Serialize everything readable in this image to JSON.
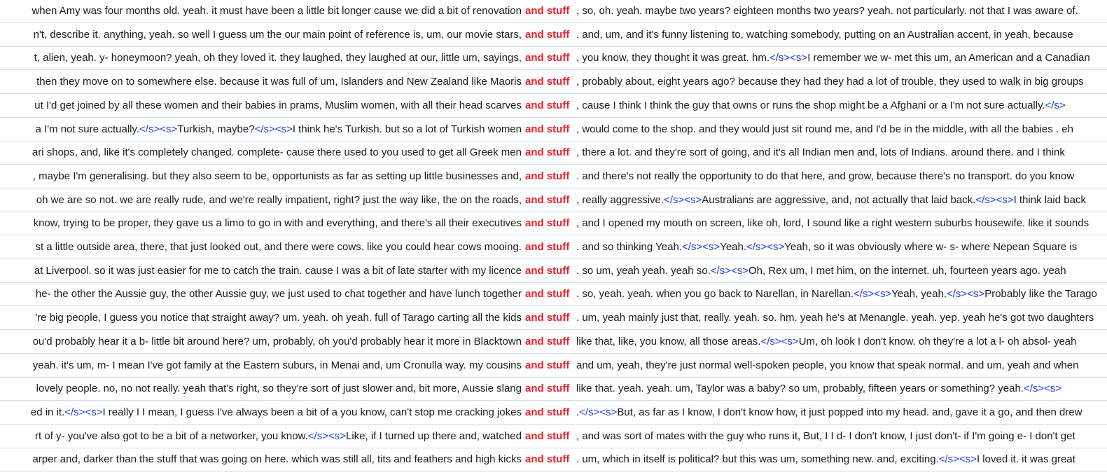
{
  "keyword": "and stuff",
  "colors": {
    "keyword": "#e8202a",
    "tag": "#1f3fe0",
    "row_border": "#c9dff0"
  },
  "rows": [
    {
      "left": "when Amy was four months old. yeah. it must have been a little bit longer cause we did a bit of renovation",
      "right": [
        " , so, oh. yeah. maybe two years? eighteen months two years? yeah. not particularly. not that I was aware of."
      ]
    },
    {
      "left": "n't, describe it. anything, yeah. so well I guess um the our main point of reference is, um, our movie stars,",
      "right": [
        " . and, um, and it's funny listening to, watching somebody, putting on an Australian accent, in yeah, because"
      ]
    },
    {
      "left": "t, alien, yeah. y- honeymoon? yeah, oh they loved it. they laughed, they laughed at our, little um, sayings,",
      "right": [
        " , you know, they thought it was great. hm.",
        "</s><s>",
        "I remember we w- met this um, an American and a Canadian"
      ]
    },
    {
      "left": "then they move on to somewhere else. because it was full of um, Islanders and New Zealand like Maoris",
      "right": [
        " , probably about, eight years ago? because they had they had a lot of trouble, they used to walk in big groups"
      ]
    },
    {
      "left": "ut I'd get joined by all these women and their babies in prams, Muslim women, with all their head scarves",
      "right": [
        " , cause I think I think the guy that owns or runs the shop might be a Afghani or a I'm not sure actually.",
        "</s>"
      ]
    },
    {
      "left": "a I'm not sure actually.</s><s>Turkish, maybe?</s><s>I think he's Turkish. but so a lot of Turkish women",
      "right": [
        " , would come to the shop. and they would just sit round me, and I'd be in the middle, with all the babies . eh"
      ]
    },
    {
      "left": "ari shops, and, like it's completely changed. complete- cause there used to you used to get all Greek men",
      "right": [
        " , there a lot. and they're sort of going, and it's all Indian men and, lots of Indians. around there. and I think"
      ]
    },
    {
      "left": ", maybe I'm generalising. but they also seem to be, opportunists as far as setting up little businesses and,",
      "right": [
        " . and there's not really the opportunity to do that here, and grow, because there's no transport. do you know"
      ]
    },
    {
      "left": "oh we are so not. we are really rude, and we're really impatient, right? just the way like, the on the roads,",
      "right": [
        " , really aggressive.",
        "</s><s>",
        "Australians are aggressive, and, not actually that laid back.",
        "</s><s>",
        "I think laid back"
      ]
    },
    {
      "left": "know, trying to be proper, they gave us a limo to go in with and everything, and there's all their executives",
      "right": [
        " , and I opened my mouth on screen, like oh, lord, I sound like a right western suburbs housewife. like it sounds"
      ]
    },
    {
      "left": "st a little outside area, there, that just looked out, and there were cows. like you could hear cows mooing.",
      "right": [
        " . and so thinking Yeah.",
        "</s><s>",
        "Yeah.",
        "</s><s>",
        "Yeah, so it was obviously where w- s- where Nepean Square is"
      ]
    },
    {
      "left": "at Liverpool. so it was just easier for me to catch the train. cause I was a bit of late starter with my licence",
      "right": [
        " . so um, yeah yeah. yeah so.",
        "</s><s>",
        "Oh, Rex um, I met him, on the internet. uh, fourteen years ago. yeah"
      ]
    },
    {
      "left": "he- the other the Aussie guy, the other Aussie guy, we just used to chat together and have lunch together",
      "right": [
        " . so, yeah. yeah. when you go back to Narellan, in Narellan.",
        "</s><s>",
        "Yeah, yeah.",
        "</s><s>",
        "Probably like the Tarago"
      ]
    },
    {
      "left": "'re big people, I guess you notice that straight away? um. yeah. oh yeah. full of Tarago carting all the kids",
      "right": [
        " . um, yeah mainly just that, really. yeah. so. hm. yeah he's at Menangle. yeah. yep. yeah he's got two daughters"
      ]
    },
    {
      "left": "ou'd probably hear it a b- little bit around here? um, probably, oh you'd probably hear it more in Blacktown",
      "right": [
        " like that, like, you know, all those areas.",
        "</s><s>",
        "Um, oh look I don't know. oh they're a lot a l- oh absol- yeah"
      ]
    },
    {
      "left": "yeah. it's um, m- I mean I've got family at the Eastern suburs, in Menai and, um Cronulla way. my cousins",
      "right": [
        " and um, yeah, they're just normal well-spoken people, you know that speak normal. and um, yeah and when"
      ]
    },
    {
      "left": "lovely people. no, no not really. yeah that's right, so they're sort of just slower and, bit more, Aussie slang",
      "right": [
        " like that. yeah. yeah. um, Taylor was a baby? so um, probably, fifteen years or something? yeah.",
        "</s><s>",
        ""
      ]
    },
    {
      "left": "ed in it.</s><s>I really I I mean, I guess I've always been a bit of a you know, can't stop me cracking jokes",
      "right": [
        " .",
        "</s><s>",
        "But, as far as I know, I don't know how, it just popped into my head. and, gave it a go, and then drew"
      ]
    },
    {
      "left": "rt of y- you've also got to be a bit of a networker, you know.</s><s>Like, if I turned up there and, watched",
      "right": [
        " , and was sort of mates with the guy who runs it, But, I I d- I don't know, I just don't- if I'm going e- I don't get"
      ]
    },
    {
      "left": "arper and, darker than the stuff that was going on here. which was still all, tits and feathers and high kicks",
      "right": [
        " . um, which in itself is political? but this was um, something new. and, exciting.",
        "</s><s>",
        "I loved it. it was great"
      ]
    }
  ]
}
